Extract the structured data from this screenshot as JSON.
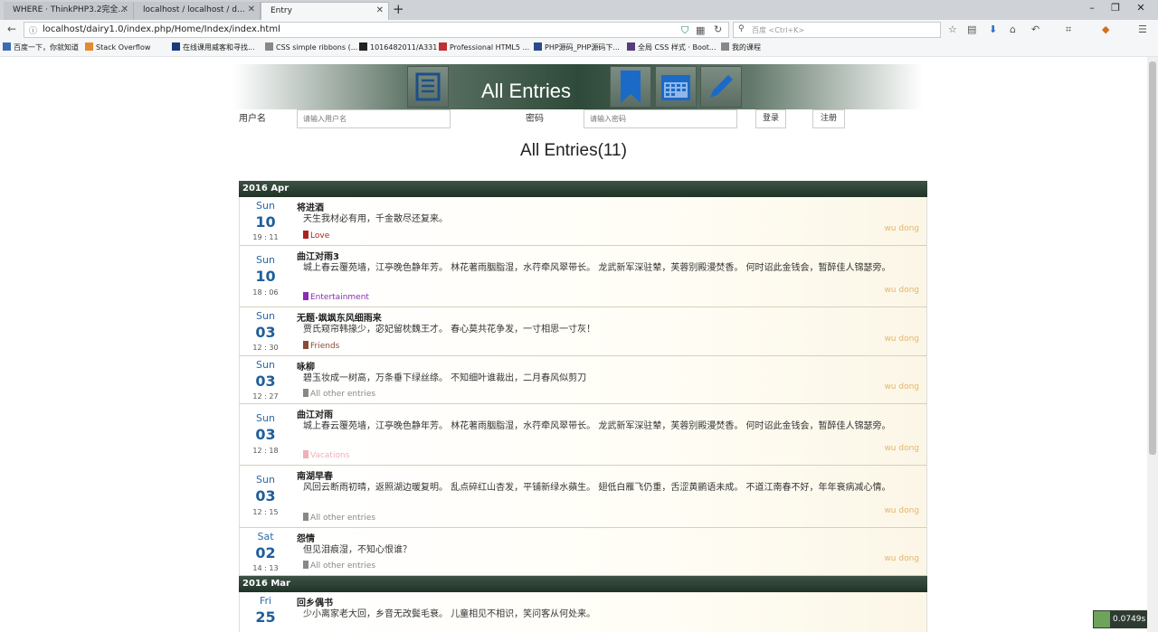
{
  "browser": {
    "tabs": [
      {
        "title": "WHERE · ThinkPHP3.2完全..."
      },
      {
        "title": "localhost / localhost / d..."
      },
      {
        "title": "Entry"
      }
    ],
    "new_tab_symbol": "+",
    "url": "localhost/dairy1.0/index.php/Home/Index/index.html",
    "search_placeholder": "百度 <Ctrl+K>",
    "bookmarks": [
      "百度一下，你就知道",
      "Stack Overflow",
      "在线课用威客和寻找...",
      "CSS simple ribbons (...",
      "1016482011/A331",
      "Professional HTML5 ...",
      "PHP源码_PHP源码下...",
      "全局 CSS 样式 · Boot...",
      "我的课程"
    ]
  },
  "header": {
    "title": "All Entries",
    "icons": [
      "list-icon",
      "bookmark-icon",
      "calendar-icon",
      "pencil-icon"
    ]
  },
  "login": {
    "username_label": "用户名",
    "username_placeholder": "请输入用户名",
    "password_label": "密码",
    "password_placeholder": "请输入密码",
    "login_button": "登录",
    "register_button": "注册"
  },
  "page_title": "All Entries(11)",
  "months": [
    {
      "label": "2016 Apr",
      "entries": [
        {
          "dow": "Sun",
          "day": "10",
          "time": "19 : 11",
          "title": "将进酒",
          "content": "天生我材必有用，千金散尽还复来。",
          "tag": "Love",
          "tag_color": "#b02020",
          "flag_color": "#b02020",
          "author": "wu dong"
        },
        {
          "dow": "Sun",
          "day": "10",
          "time": "18 : 06",
          "title": "曲江对雨3",
          "content": "城上春云覆苑墙，江亭晚色静年芳。 林花著雨胭脂湿，水荇牵风翠带长。 龙武新军深驻辇，芙蓉别殿漫焚香。 何时诏此金钱会，暂醉佳人锦瑟旁。",
          "tag": "Entertainment",
          "tag_color": "#8a2bb5",
          "flag_color": "#8a2bb5",
          "author": "wu dong"
        },
        {
          "dow": "Sun",
          "day": "03",
          "time": "12 : 30",
          "title": "无题·飒飒东风细雨来",
          "content": "贾氏窥帘韩掾少，宓妃留枕魏王才。 春心莫共花争发，一寸相思一寸灰！",
          "tag": "Friends",
          "tag_color": "#8a4a3a",
          "flag_color": "#8a4a3a",
          "author": "wu dong"
        },
        {
          "dow": "Sun",
          "day": "03",
          "time": "12 : 27",
          "title": "咏柳",
          "content": "碧玉妆成一树高，万条垂下绿丝绦。 不知细叶谁裁出，二月春风似剪刀",
          "tag": "All    other    entries",
          "tag_color": "#888888",
          "flag_color": "#888888",
          "author": "wu dong"
        },
        {
          "dow": "Sun",
          "day": "03",
          "time": "12 : 18",
          "title": "曲江对雨",
          "content": "城上春云覆苑墙，江亭晚色静年芳。 林花著雨胭脂湿，水荇牵风翠带长。 龙武新军深驻辇，芙蓉别殿漫焚香。 何时诏此金钱会，暂醉佳人锦瑟旁。",
          "tag": "Vacations",
          "tag_color": "#f0b0b8",
          "flag_color": "#f0b0b8",
          "author": "wu dong"
        },
        {
          "dow": "Sun",
          "day": "03",
          "time": "12 : 15",
          "title": "南湖早春",
          "content": "风回云断雨初晴，返照湖边暖复明。 乱点碎红山杏发，平铺新绿水蘋生。 翅低白雁飞仍重，舌涩黄鹂语未成。 不道江南春不好，年年衰病减心情。",
          "tag": "All    other    entries",
          "tag_color": "#888888",
          "flag_color": "#888888",
          "author": "wu dong"
        },
        {
          "dow": "Sat",
          "day": "02",
          "time": "14 : 13",
          "title": "怨情",
          "content": "但见泪痕湿，不知心恨谁？",
          "tag": "All    other    entries",
          "tag_color": "#888888",
          "flag_color": "#888888",
          "author": "wu dong"
        }
      ]
    },
    {
      "label": "2016 Mar",
      "entries": [
        {
          "dow": "Fri",
          "day": "25",
          "time": "",
          "title": "回乡偶书",
          "content": "少小离家老大回，乡音无改鬓毛衰。 儿童相见不相识，笑问客从何处来。",
          "tag": "",
          "tag_color": "#888888",
          "flag_color": "#888888",
          "author": ""
        }
      ]
    }
  ],
  "perf_badge": "0.0749s"
}
